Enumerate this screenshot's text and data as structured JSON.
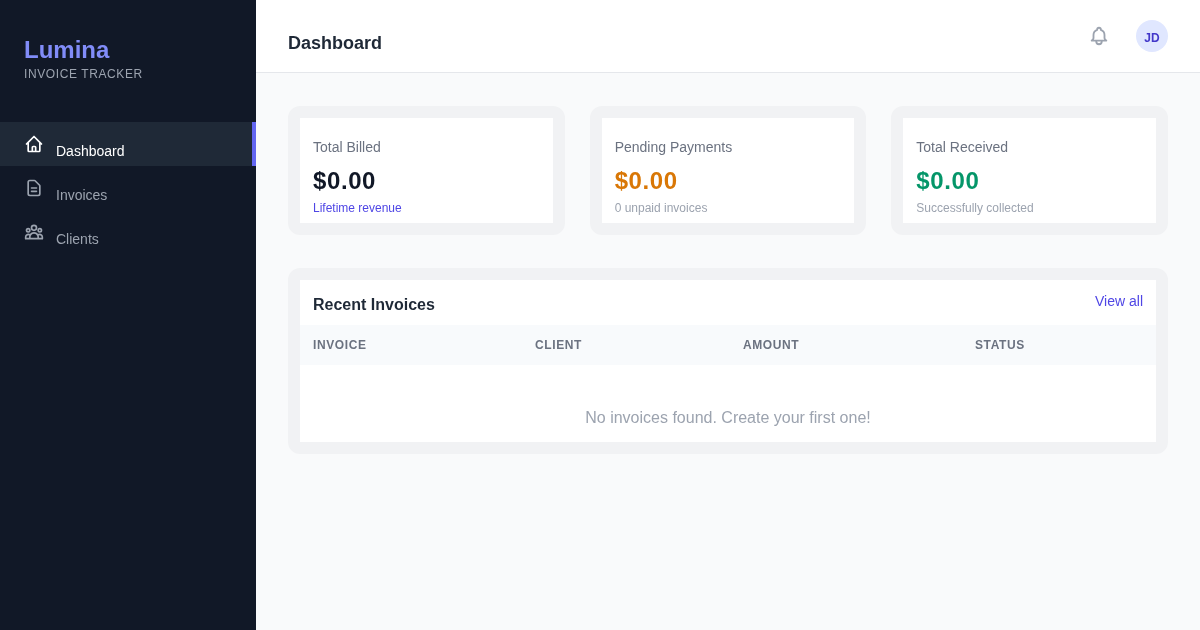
{
  "sidebar": {
    "logo": "Lumina",
    "subtitle": "INVOICE TRACKER",
    "items": [
      {
        "label": "Dashboard",
        "selected": true
      },
      {
        "label": "Invoices",
        "selected": false
      },
      {
        "label": "Clients",
        "selected": false
      }
    ]
  },
  "header": {
    "title": "Dashboard",
    "avatar_initials": "JD"
  },
  "stats": [
    {
      "label": "Total Billed",
      "value": "$0.00",
      "color": "#111827",
      "note": "Lifetime revenue",
      "note_highlighted": true
    },
    {
      "label": "Pending Payments",
      "value": "$0.00",
      "color": "#d97706",
      "note": "0 unpaid invoices",
      "note_highlighted": false
    },
    {
      "label": "Total Received",
      "value": "$0.00",
      "color": "#059669",
      "note": "Successfully collected",
      "note_highlighted": false
    }
  ],
  "recent_invoices": {
    "title": "Recent Invoices",
    "link": "View all",
    "columns": [
      "INVOICE",
      "CLIENT",
      "AMOUNT",
      "STATUS"
    ],
    "empty_message": "No invoices found. Create your first one!"
  }
}
